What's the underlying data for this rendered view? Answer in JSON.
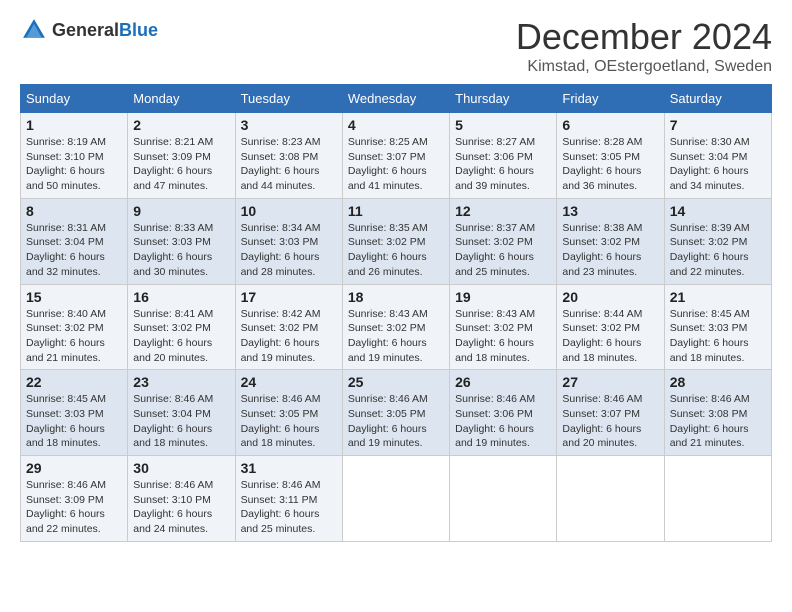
{
  "header": {
    "logo_general": "General",
    "logo_blue": "Blue",
    "title": "December 2024",
    "subtitle": "Kimstad, OEstergoetland, Sweden"
  },
  "calendar": {
    "days_of_week": [
      "Sunday",
      "Monday",
      "Tuesday",
      "Wednesday",
      "Thursday",
      "Friday",
      "Saturday"
    ],
    "weeks": [
      [
        {
          "day": "1",
          "sunrise": "8:19 AM",
          "sunset": "3:10 PM",
          "daylight": "6 hours and 50 minutes."
        },
        {
          "day": "2",
          "sunrise": "8:21 AM",
          "sunset": "3:09 PM",
          "daylight": "6 hours and 47 minutes."
        },
        {
          "day": "3",
          "sunrise": "8:23 AM",
          "sunset": "3:08 PM",
          "daylight": "6 hours and 44 minutes."
        },
        {
          "day": "4",
          "sunrise": "8:25 AM",
          "sunset": "3:07 PM",
          "daylight": "6 hours and 41 minutes."
        },
        {
          "day": "5",
          "sunrise": "8:27 AM",
          "sunset": "3:06 PM",
          "daylight": "6 hours and 39 minutes."
        },
        {
          "day": "6",
          "sunrise": "8:28 AM",
          "sunset": "3:05 PM",
          "daylight": "6 hours and 36 minutes."
        },
        {
          "day": "7",
          "sunrise": "8:30 AM",
          "sunset": "3:04 PM",
          "daylight": "6 hours and 34 minutes."
        }
      ],
      [
        {
          "day": "8",
          "sunrise": "8:31 AM",
          "sunset": "3:04 PM",
          "daylight": "6 hours and 32 minutes."
        },
        {
          "day": "9",
          "sunrise": "8:33 AM",
          "sunset": "3:03 PM",
          "daylight": "6 hours and 30 minutes."
        },
        {
          "day": "10",
          "sunrise": "8:34 AM",
          "sunset": "3:03 PM",
          "daylight": "6 hours and 28 minutes."
        },
        {
          "day": "11",
          "sunrise": "8:35 AM",
          "sunset": "3:02 PM",
          "daylight": "6 hours and 26 minutes."
        },
        {
          "day": "12",
          "sunrise": "8:37 AM",
          "sunset": "3:02 PM",
          "daylight": "6 hours and 25 minutes."
        },
        {
          "day": "13",
          "sunrise": "8:38 AM",
          "sunset": "3:02 PM",
          "daylight": "6 hours and 23 minutes."
        },
        {
          "day": "14",
          "sunrise": "8:39 AM",
          "sunset": "3:02 PM",
          "daylight": "6 hours and 22 minutes."
        }
      ],
      [
        {
          "day": "15",
          "sunrise": "8:40 AM",
          "sunset": "3:02 PM",
          "daylight": "6 hours and 21 minutes."
        },
        {
          "day": "16",
          "sunrise": "8:41 AM",
          "sunset": "3:02 PM",
          "daylight": "6 hours and 20 minutes."
        },
        {
          "day": "17",
          "sunrise": "8:42 AM",
          "sunset": "3:02 PM",
          "daylight": "6 hours and 19 minutes."
        },
        {
          "day": "18",
          "sunrise": "8:43 AM",
          "sunset": "3:02 PM",
          "daylight": "6 hours and 19 minutes."
        },
        {
          "day": "19",
          "sunrise": "8:43 AM",
          "sunset": "3:02 PM",
          "daylight": "6 hours and 18 minutes."
        },
        {
          "day": "20",
          "sunrise": "8:44 AM",
          "sunset": "3:02 PM",
          "daylight": "6 hours and 18 minutes."
        },
        {
          "day": "21",
          "sunrise": "8:45 AM",
          "sunset": "3:03 PM",
          "daylight": "6 hours and 18 minutes."
        }
      ],
      [
        {
          "day": "22",
          "sunrise": "8:45 AM",
          "sunset": "3:03 PM",
          "daylight": "6 hours and 18 minutes."
        },
        {
          "day": "23",
          "sunrise": "8:46 AM",
          "sunset": "3:04 PM",
          "daylight": "6 hours and 18 minutes."
        },
        {
          "day": "24",
          "sunrise": "8:46 AM",
          "sunset": "3:05 PM",
          "daylight": "6 hours and 18 minutes."
        },
        {
          "day": "25",
          "sunrise": "8:46 AM",
          "sunset": "3:05 PM",
          "daylight": "6 hours and 19 minutes."
        },
        {
          "day": "26",
          "sunrise": "8:46 AM",
          "sunset": "3:06 PM",
          "daylight": "6 hours and 19 minutes."
        },
        {
          "day": "27",
          "sunrise": "8:46 AM",
          "sunset": "3:07 PM",
          "daylight": "6 hours and 20 minutes."
        },
        {
          "day": "28",
          "sunrise": "8:46 AM",
          "sunset": "3:08 PM",
          "daylight": "6 hours and 21 minutes."
        }
      ],
      [
        {
          "day": "29",
          "sunrise": "8:46 AM",
          "sunset": "3:09 PM",
          "daylight": "6 hours and 22 minutes."
        },
        {
          "day": "30",
          "sunrise": "8:46 AM",
          "sunset": "3:10 PM",
          "daylight": "6 hours and 24 minutes."
        },
        {
          "day": "31",
          "sunrise": "8:46 AM",
          "sunset": "3:11 PM",
          "daylight": "6 hours and 25 minutes."
        },
        null,
        null,
        null,
        null
      ]
    ]
  }
}
